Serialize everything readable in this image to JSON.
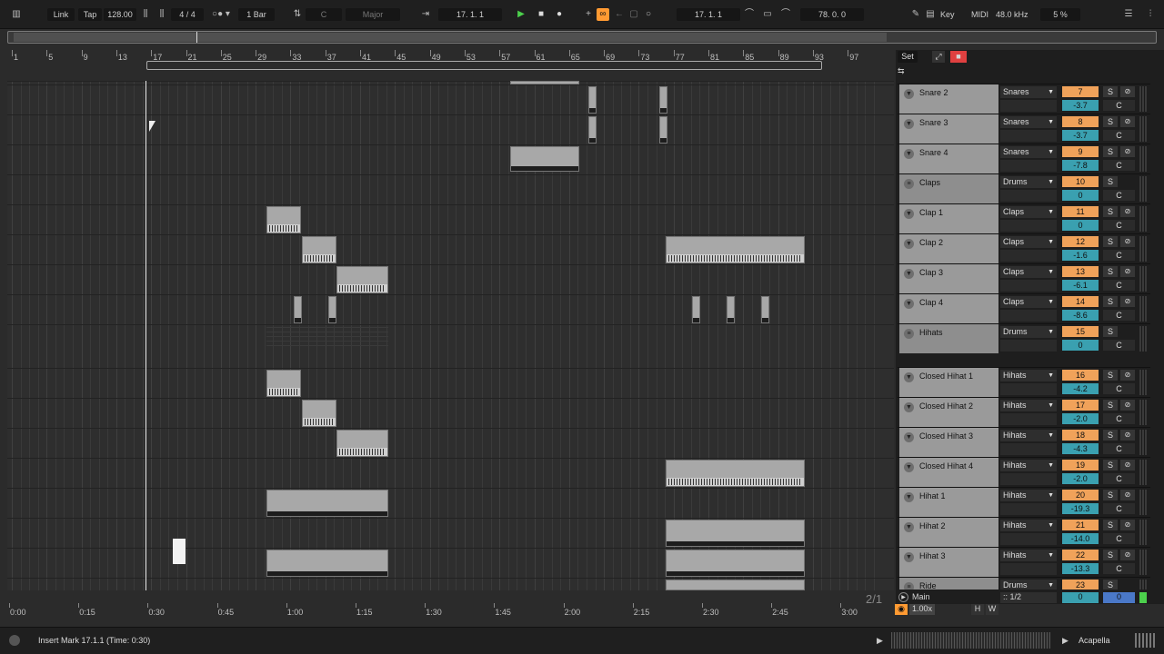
{
  "transport": {
    "link": "Link",
    "tap": "Tap",
    "tempo": "128.00",
    "signature": "4 / 4",
    "quantize": "1 Bar",
    "key_root": "C",
    "scale": "Major",
    "arrangement_position": "17.   1.   1",
    "loop_start": "17.   1.   1",
    "loop_length": "78.   0.   0",
    "key_label": "Key",
    "midi_label": "MIDI",
    "sample_rate": "48.0 kHz",
    "cpu": "5 %"
  },
  "ruler": {
    "bars": [
      "1",
      "5",
      "9",
      "13",
      "17",
      "21",
      "25",
      "29",
      "33",
      "37",
      "41",
      "45",
      "49",
      "53",
      "57",
      "61",
      "65",
      "69",
      "73",
      "77",
      "81",
      "85",
      "89",
      "93",
      "97"
    ]
  },
  "time_ruler": {
    "labels": [
      "0:00",
      "0:15",
      "0:30",
      "0:45",
      "1:00",
      "1:15",
      "1:30",
      "1:45",
      "2:00",
      "2:15",
      "2:30",
      "2:45",
      "3:00"
    ]
  },
  "mixer": {
    "set_label": "Set",
    "tracks": [
      {
        "name": "Snare 2",
        "route": "Snares",
        "num": "7",
        "vol": "-3.7"
      },
      {
        "name": "Snare 3",
        "route": "Snares",
        "num": "8",
        "vol": "-3.7"
      },
      {
        "name": "Snare 4",
        "route": "Snares",
        "num": "9",
        "vol": "-7.8"
      },
      {
        "name": "Claps",
        "route": "Drums",
        "num": "10",
        "vol": "0"
      },
      {
        "name": "Clap 1",
        "route": "Claps",
        "num": "11",
        "vol": "0"
      },
      {
        "name": "Clap 2",
        "route": "Claps",
        "num": "12",
        "vol": "-1.6"
      },
      {
        "name": "Clap 3",
        "route": "Claps",
        "num": "13",
        "vol": "-6.1"
      },
      {
        "name": "Clap 4",
        "route": "Claps",
        "num": "14",
        "vol": "-8.6"
      },
      {
        "name": "Hihats",
        "route": "Drums",
        "num": "15",
        "vol": "0"
      },
      {
        "name": "Closed Hihat 1",
        "route": "Hihats",
        "num": "16",
        "vol": "-4.2"
      },
      {
        "name": "Closed Hihat 2",
        "route": "Hihats",
        "num": "17",
        "vol": "-2.0"
      },
      {
        "name": "Closed Hihat 3",
        "route": "Hihats",
        "num": "18",
        "vol": "-4.3"
      },
      {
        "name": "Closed Hihat 4",
        "route": "Hihats",
        "num": "19",
        "vol": "-2.0"
      },
      {
        "name": "Hihat 1",
        "route": "Hihats",
        "num": "20",
        "vol": "-19.3"
      },
      {
        "name": "Hihat 2",
        "route": "Hihats",
        "num": "21",
        "vol": "-14.0"
      },
      {
        "name": "Hihat 3",
        "route": "Hihats",
        "num": "22",
        "vol": "-13.3"
      },
      {
        "name": "Ride",
        "route": "Drums",
        "num": "23",
        "vol": ""
      }
    ],
    "main": {
      "label": "Main",
      "ratio": "2/1",
      "route": ":: 1/2",
      "vol": "0",
      "pan": "0"
    }
  },
  "status": {
    "message": "Insert Mark 17.1.1 (Time: 0:30)",
    "zoom": "1.00x",
    "h": "H",
    "w": "W",
    "track_name": "Acapella"
  },
  "colors": {
    "accent": "#ff9a32",
    "clip": "#a8a8a8",
    "track_num": "#f0a25a",
    "volume": "#3aa0b0"
  }
}
